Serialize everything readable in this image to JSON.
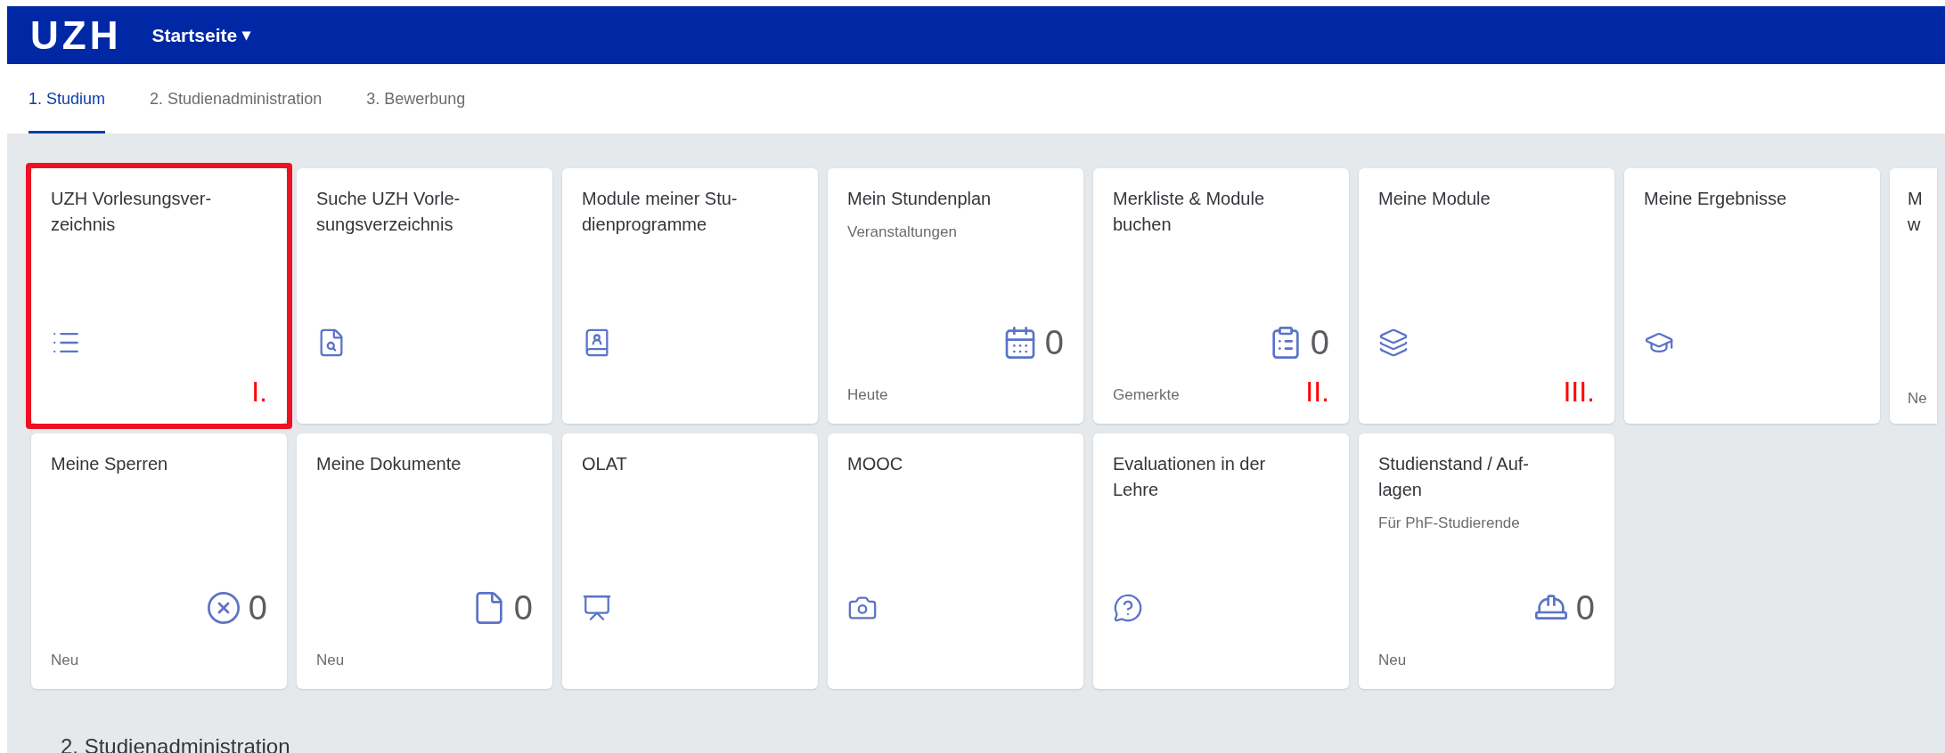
{
  "header": {
    "logo": "UZH",
    "menu": "Startseite",
    "menu_caret": "▾"
  },
  "tabs": [
    {
      "label": "1. Studium",
      "selected": true
    },
    {
      "label": "2. Studienadministration",
      "selected": false
    },
    {
      "label": "3. Bewerbung",
      "selected": false
    }
  ],
  "tile_rows": [
    {
      "tiles": [
        {
          "kind": "full",
          "title_lines": [
            "UZH Vorlesungsver-",
            "zeichnis"
          ],
          "annotation": "I.",
          "highlighted": true
        },
        {
          "kind": "full",
          "title_lines": [
            "Suche UZH Vorle-",
            "sungsverzeichnis"
          ],
          "highlighted": false
        },
        {
          "kind": "full",
          "title_lines": [
            "Module meiner Stu-",
            "dienprogramme"
          ],
          "highlighted": false
        },
        {
          "kind": "full",
          "title_lines": [
            "Mein Stundenplan"
          ],
          "subtitle": "Veranstaltungen",
          "count": "0",
          "footer": "Heute",
          "highlighted": false
        },
        {
          "kind": "full",
          "title_lines": [
            "Merkliste & Module",
            "buchen"
          ],
          "count": "0",
          "footer": "Gemerkte",
          "annotation": "II.",
          "highlighted": false
        },
        {
          "kind": "full",
          "title_lines": [
            "Meine Module"
          ],
          "annotation": "III.",
          "highlighted": false
        },
        {
          "kind": "full",
          "title_lines": [
            "Meine Ergebnisse"
          ],
          "highlighted": false
        },
        {
          "kind": "partial",
          "title_lines": [
            "M",
            "w"
          ],
          "footer": "Ne"
        }
      ]
    },
    {
      "tiles": [
        {
          "kind": "full",
          "title_lines": [
            "Meine Sperren"
          ],
          "count": "0",
          "footer": "Neu",
          "highlighted": false
        },
        {
          "kind": "full",
          "title_lines": [
            "Meine Dokumente"
          ],
          "count": "0",
          "footer": "Neu",
          "highlighted": false
        },
        {
          "kind": "full",
          "title_lines": [
            "OLAT"
          ],
          "highlighted": false
        },
        {
          "kind": "full",
          "title_lines": [
            "MOOC"
          ],
          "highlighted": false
        },
        {
          "kind": "full",
          "title_lines": [
            "Evaluationen in der",
            "Lehre"
          ],
          "highlighted": false
        },
        {
          "kind": "full",
          "title_lines": [
            "Studienstand / Auf-",
            "lagen"
          ],
          "subtitle": "Für PhF-Studierende",
          "count": "0",
          "footer": "Neu",
          "highlighted": false
        }
      ]
    }
  ],
  "section_heading": "2. Studienadministration"
}
